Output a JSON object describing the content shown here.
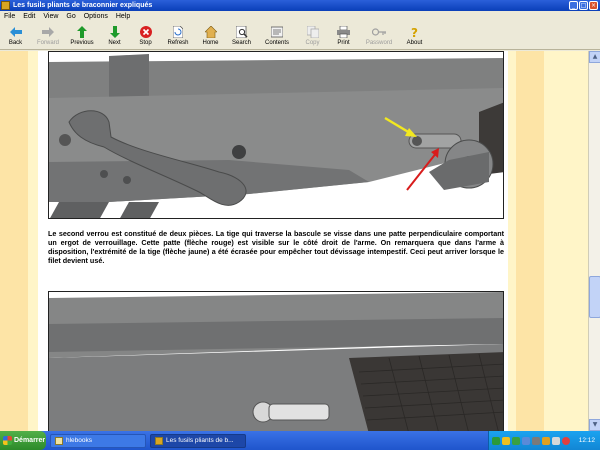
{
  "window": {
    "title": "Les fusils pliants de braconnier expliqués"
  },
  "menu": [
    "File",
    "Edit",
    "View",
    "Go",
    "Options",
    "Help"
  ],
  "toolbar": {
    "back": "Back",
    "forward": "Forward",
    "previous": "Previous",
    "next": "Next",
    "stop": "Stop",
    "refresh": "Refresh",
    "home": "Home",
    "search": "Search",
    "contents": "Contents",
    "copy": "Copy",
    "print": "Print",
    "password": "Password",
    "about": "About"
  },
  "colors": {
    "arrow_yellow": "#f2e820",
    "arrow_red": "#d81c1c",
    "page_bg": "#fff5c8",
    "stripe": "#fde4a6"
  },
  "content": {
    "caption": "Le second verrou est constitué de deux pièces. La tige qui traverse la bascule se visse dans une patte perpendiculaire comportant un ergot de verrouillage. Cette patte (flèche rouge) est visible sur le côté droit de l'arme. On remarquera que dans l'arme à disposition, l'extrémité de la tige (flèche jaune) a été écrasée pour empêcher tout dévissage intempestif. Ceci peut arriver lorsque le filet devient usé."
  },
  "taskbar": {
    "start": "Démarrer",
    "task1": "hlebooks",
    "task2": "Les fusils pliants de b...",
    "clock": "12:12"
  }
}
